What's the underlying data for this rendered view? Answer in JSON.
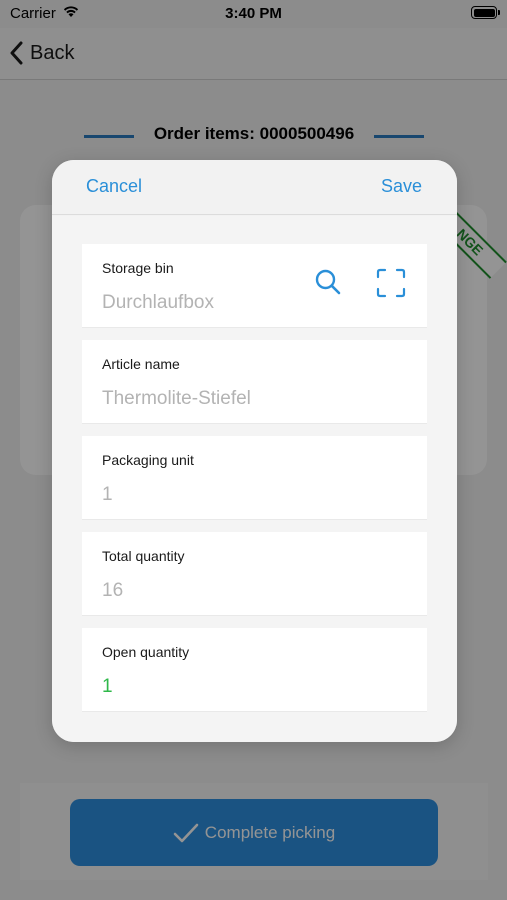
{
  "status_bar": {
    "carrier": "Carrier",
    "time": "3:40 PM"
  },
  "navbar": {
    "back_label": "Back"
  },
  "page": {
    "title": "Order items: 0000500496"
  },
  "background": {
    "ribbon_text": "NGE",
    "complete_button_label": "Complete picking"
  },
  "modal": {
    "cancel_label": "Cancel",
    "save_label": "Save",
    "fields": [
      {
        "label": "Storage bin",
        "value": "Durchlaufbox"
      },
      {
        "label": "Article name",
        "value": "Thermolite-Stiefel"
      },
      {
        "label": "Packaging unit",
        "value": "1"
      },
      {
        "label": "Total quantity",
        "value": "16"
      },
      {
        "label": "Open quantity",
        "value": "1"
      }
    ],
    "icons": [
      "search-icon",
      "scan-icon"
    ]
  },
  "colors": {
    "accent_blue": "#2a8fd8",
    "button_blue": "#2d8fe0",
    "title_line": "#2a7bbf",
    "ribbon_green": "#1f8f2e",
    "open_quantity_green": "#2fb84a",
    "placeholder_grey": "#b3b3b3"
  }
}
